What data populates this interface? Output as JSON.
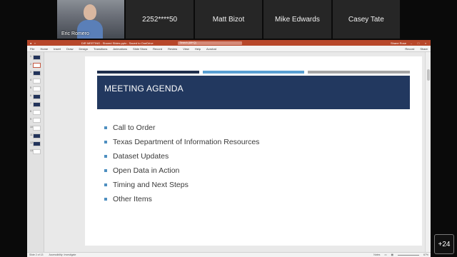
{
  "participants": [
    {
      "name": "Eric Romero",
      "video": true
    },
    {
      "name": "2252****50",
      "video": false
    },
    {
      "name": "Matt Bizot",
      "video": false
    },
    {
      "name": "Mike Edwards",
      "video": false
    },
    {
      "name": "Casey Tate",
      "video": false
    }
  ],
  "overflow_badge": "+24",
  "ppt": {
    "title": "DIR MEETING - Shared Slides.pptx - Saved to OneDrive",
    "search_placeholder": "Search (Alt+Q)",
    "user": "Shane Rose",
    "tabs": [
      "File",
      "Home",
      "Insert",
      "Draw",
      "Design",
      "Transitions",
      "Animations",
      "Slide Show",
      "Record",
      "Review",
      "View",
      "Help",
      "Acrobat"
    ],
    "ribbon_right": [
      "Record",
      "Share"
    ],
    "thumbnail_numbers": [
      "1",
      "2",
      "3",
      "4",
      "5",
      "6",
      "7",
      "8",
      "9",
      "10",
      "11",
      "12",
      "13"
    ],
    "status_left": "Slide 2 of 13",
    "status_accessibility": "Accessibility: Investigate",
    "status_notes": "Notes",
    "zoom": "67%"
  },
  "slide": {
    "title": "MEETING AGENDA",
    "items": [
      "Call to Order",
      "Texas Department of Information Resources",
      "Dataset Updates",
      "Open Data in Action",
      "Timing and Next Steps",
      "Other Items"
    ]
  },
  "colors": {
    "accent": "#b7472a",
    "title_band": "#22385f",
    "bullet": "#4e8fc0"
  }
}
